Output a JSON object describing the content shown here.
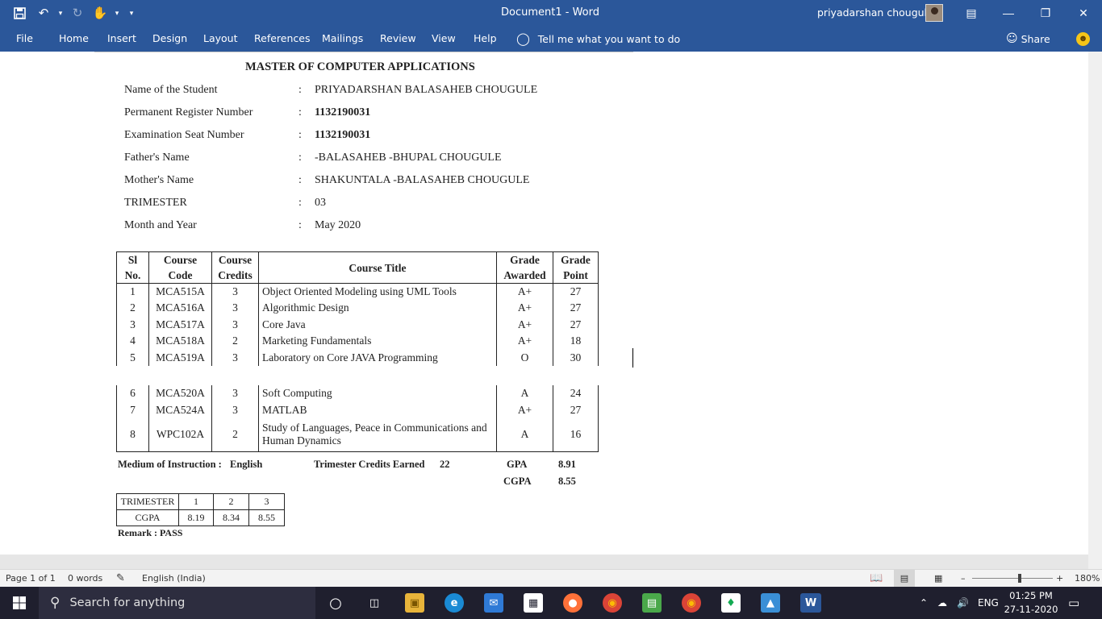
{
  "window": {
    "title": "Document1  -  Word",
    "user": "priyadarshan chougule"
  },
  "ribbon": {
    "tabs": [
      "File",
      "Home",
      "Insert",
      "Design",
      "Layout",
      "References",
      "Mailings",
      "Review",
      "View",
      "Help"
    ],
    "tell_me": "Tell me what you want to do",
    "share": "Share"
  },
  "document": {
    "heading": "MASTER OF COMPUTER APPLICATIONS",
    "info": [
      {
        "label": "Name of the Student",
        "value": "PRIYADARSHAN BALASAHEB CHOUGULE"
      },
      {
        "label": "Permanent Register Number",
        "value": "1132190031"
      },
      {
        "label": "Examination Seat Number",
        "value": "1132190031"
      },
      {
        "label": "Father's Name",
        "value": "-BALASAHEB -BHUPAL CHOUGULE"
      },
      {
        "label": "Mother's Name",
        "value": "SHAKUNTALA -BALASAHEB CHOUGULE"
      },
      {
        "label": "TRIMESTER",
        "value": "03"
      },
      {
        "label": "Month and Year",
        "value": "May 2020"
      }
    ],
    "colon": ":",
    "table_headers": {
      "sl_1": "Sl",
      "sl_2": "No.",
      "code_1": "Course",
      "code_2": "Code",
      "credits_1": "Course",
      "credits_2": "Credits",
      "title": "Course Title",
      "grade_1": "Grade",
      "grade_2": "Awarded",
      "point_1": "Grade",
      "point_2": "Point"
    },
    "courses_part1": [
      {
        "sl": "1",
        "code": "MCA515A",
        "credits": "3",
        "title": "Object Oriented Modeling using UML Tools",
        "grade": "A+",
        "point": "27"
      },
      {
        "sl": "2",
        "code": "MCA516A",
        "credits": "3",
        "title": "Algorithmic Design",
        "grade": "A+",
        "point": "27"
      },
      {
        "sl": "3",
        "code": "MCA517A",
        "credits": "3",
        "title": "Core Java",
        "grade": "A+",
        "point": "27"
      },
      {
        "sl": "4",
        "code": "MCA518A",
        "credits": "2",
        "title": "Marketing Fundamentals",
        "grade": "A+",
        "point": "18"
      },
      {
        "sl": "5",
        "code": "MCA519A",
        "credits": "3",
        "title": "Laboratory on Core JAVA Programming",
        "grade": "O",
        "point": "30"
      }
    ],
    "courses_part2": [
      {
        "sl": "6",
        "code": "MCA520A",
        "credits": "3",
        "title": "Soft Computing",
        "grade": "A",
        "point": "24"
      },
      {
        "sl": "7",
        "code": "MCA524A",
        "credits": "3",
        "title": "MATLAB",
        "grade": "A+",
        "point": "27"
      },
      {
        "sl": "8",
        "code": "WPC102A",
        "credits": "2",
        "title_1": "Study of Languages, Peace in Communications and",
        "title_2": "Human Dynamics",
        "grade": "A",
        "point": "16"
      }
    ],
    "summary": {
      "medium_label": "Medium of Instruction :",
      "medium_value": "English",
      "credits_label": "Trimester Credits Earned",
      "credits_value": "22",
      "gpa_label": "GPA",
      "gpa_value": "8.91",
      "cgpa_label": "CGPA",
      "cgpa_value": "8.55"
    },
    "cgpa_table": {
      "row1": [
        "TRIMESTER",
        "1",
        "2",
        "3"
      ],
      "row2": [
        "CGPA",
        "8.19",
        "8.34",
        "8.55"
      ]
    },
    "remark": "Remark : PASS"
  },
  "statusbar": {
    "page": "Page 1 of 1",
    "words": "0 words",
    "language": "English (India)",
    "zoom": "180%"
  },
  "taskbar": {
    "search_placeholder": "Search for anything",
    "lang": "ENG",
    "time": "01:25 PM",
    "date": "27-11-2020"
  }
}
